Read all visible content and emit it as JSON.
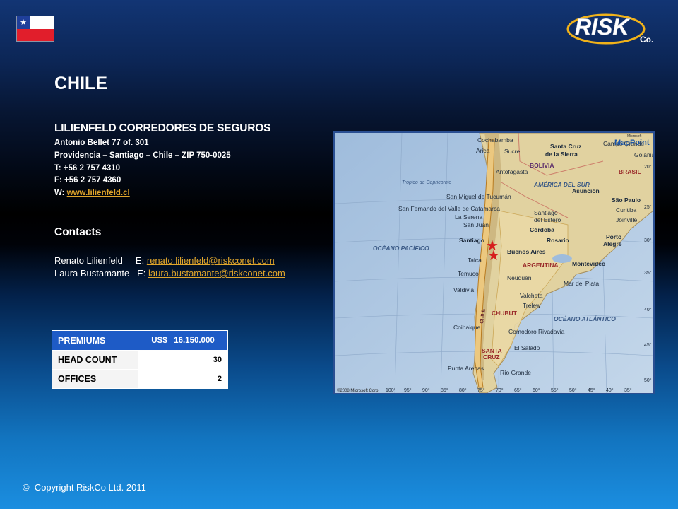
{
  "country": "CHILE",
  "company": {
    "name": "LILIENFELD CORREDORES DE SEGUROS",
    "address_line1": "Antonio Bellet 77 of. 301",
    "address_line2": "Providencia – Santiago – Chile – ZIP 750-0025",
    "phone": "T: +56 2 757 4310",
    "fax": "F: +56 2 757 4360",
    "web_prefix": "W: ",
    "web": "www.lilienfeld.cl"
  },
  "contacts": {
    "heading": "Contacts",
    "people": [
      {
        "name": "Renato Lilienfeld",
        "email_prefix": "E: ",
        "email": "renato.lilienfeld@riskconet.com"
      },
      {
        "name": "Laura Bustamante",
        "email_prefix": "E: ",
        "email": "laura.bustamante@riskconet.com"
      }
    ]
  },
  "stats": [
    {
      "label": "PREMIUMS",
      "value": "US$   16.150.000"
    },
    {
      "label": "HEAD COUNT",
      "value": "30"
    },
    {
      "label": "OFFICES",
      "value": "2"
    }
  ],
  "map": {
    "labels": {
      "cochabamba": "Cochabamba",
      "arica": "Arica",
      "sucre": "Sucre",
      "santa_cruz_sierra_1": "Santa Cruz",
      "santa_cruz_sierra_2": "de la Sierra",
      "campo_grande": "Campo Grande",
      "goiania": "Goiânia",
      "bolivia": "BOLIVIA",
      "brasil": "BRASIL",
      "antofagasta": "Antofagasta",
      "tropico": "Trópico de Capricornio",
      "america_sur": "AMÉRICA DEL SUR",
      "asuncion": "Asunción",
      "san_miguel": "San Miguel de Tucumán",
      "san_fernando": "San Fernando del Valle de Catamarca",
      "sao_paulo": "São Paulo",
      "la_serena": "La Serena",
      "santiago_estero_1": "Santiago",
      "santiago_estero_2": "del Estero",
      "curitiba": "Curitiba",
      "joinville": "Joinville",
      "san_juan": "San Juan",
      "cordoba": "Córdoba",
      "santiago": "Santiago",
      "rosario": "Rosario",
      "porto_alegre_1": "Porto",
      "porto_alegre_2": "Alegre",
      "oceano_pacifico": "OCÉANO PACÍFICO",
      "buenos_aires": "Buenos Aires",
      "talca": "Talca",
      "argentina": "ARGENTINA",
      "montevideo": "Montevideo",
      "temuco": "Temuco",
      "neuquen": "Neuquén",
      "valdivia": "Valdivia",
      "mar_del_plata": "Mar del Plata",
      "valcheta": "Valcheta",
      "trelew": "Trelew",
      "chile": "CHILE",
      "chubut": "CHUBUT",
      "oceano_atlantico": "OCÉANO ATLÁNTICO",
      "coihaique": "Coihaique",
      "comodoro": "Comodoro Rivadavia",
      "el_salado": "El Salado",
      "santa_cruz_1": "SANTA",
      "santa_cruz_2": "CRUZ",
      "punta_arenas": "Punta Arenas",
      "rio_grande": "Río Grande",
      "brand": "MapPoint",
      "brand_small": "Microsoft",
      "credit": "©2008 Microsoft Corp"
    },
    "lat_ticks": [
      "20°",
      "25°",
      "30°",
      "35°",
      "40°",
      "45°",
      "50°"
    ],
    "lon_ticks": [
      "100°",
      "95°",
      "90°",
      "85°",
      "80°",
      "75°",
      "70°",
      "65°",
      "60°",
      "55°",
      "50°",
      "45°",
      "40°",
      "35°"
    ]
  },
  "logo": {
    "main": "RISK",
    "sub": "Co."
  },
  "copyright": "©  Copyright RiskCo Ltd. 2011"
}
